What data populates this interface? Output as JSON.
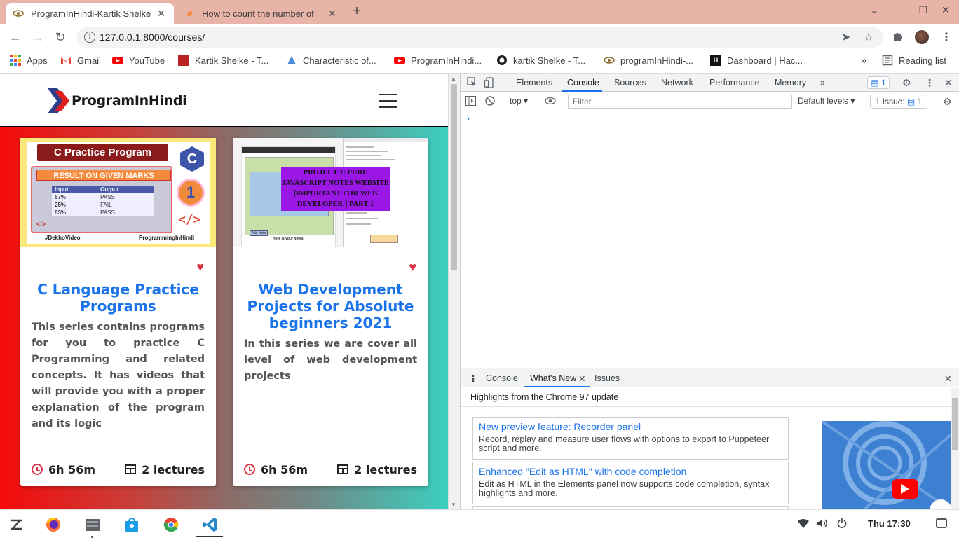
{
  "browser": {
    "tabs": [
      {
        "title": "ProgramInHindi-Kartik Shelke",
        "active": true
      },
      {
        "title": "How to count the number of",
        "active": false
      }
    ],
    "new_tab_label": "+",
    "url": "127.0.0.1:8000/courses/",
    "bookmarks": [
      {
        "label": "Apps",
        "icon": "apps-grid-icon"
      },
      {
        "label": "Gmail",
        "icon": "gmail-icon"
      },
      {
        "label": "YouTube",
        "icon": "youtube-icon"
      },
      {
        "label": "Kartik Shelke - T...",
        "icon": "bookmark-favicon"
      },
      {
        "label": "Characteristic of...",
        "icon": "bookmark-favicon"
      },
      {
        "label": "ProgramInHindi...",
        "icon": "youtube-icon"
      },
      {
        "label": "kartik Shelke - T...",
        "icon": "github-icon"
      },
      {
        "label": "programInHindi-...",
        "icon": "eye-favicon"
      },
      {
        "label": "Dashboard | Hac...",
        "icon": "hackerrank-icon"
      }
    ],
    "more_bookmarks": "»",
    "reading_list": "Reading list"
  },
  "site": {
    "logo_text": "ProgramInHindi",
    "cards": [
      {
        "title": "C Language Practice Programs",
        "description": "This series contains programs for you to practice C Programming and related concepts. It has videos that will provide you with a proper explanation of the program and its logic",
        "duration": "6h 56m",
        "lectures": "2 lectures",
        "thumb": {
          "header": "C Practice Program",
          "result": "RESULT ON GIVEN MARKS",
          "table_headers": [
            "Input",
            "Output"
          ],
          "table_rows": [
            [
              "67%",
              "PASS"
            ],
            [
              "25%",
              "FAIL"
            ],
            [
              "83%",
              "PASS"
            ]
          ],
          "c_letter": "C",
          "number": "1",
          "code_mark": "</>",
          "tag_left": "#DekhoVideo",
          "tag_right": "ProgrammingInHindi"
        }
      },
      {
        "title": "Web Development Projects for Absolute beginners 2021",
        "description": "In this series we are cover all level of web development projects",
        "duration": "6h 56m",
        "lectures": "2 lectures",
        "thumb": {
          "badge": "PROJECT 1: PURE JAVASCRIPT NOTES WEBSITE [IMPORTANT FOR WEB DEVELOPER ] PART 1",
          "notes_caption": "Here is your notes",
          "add_button": "Add Note"
        }
      }
    ]
  },
  "devtools": {
    "tabs": [
      "Elements",
      "Console",
      "Sources",
      "Network",
      "Performance",
      "Memory"
    ],
    "active_tab": "Console",
    "more": "»",
    "issue_count": "1",
    "context": "top",
    "filter_placeholder": "Filter",
    "levels": "Default levels",
    "issues_label": "1 Issue:",
    "issues_count": "1",
    "prompt": "›",
    "drawer": {
      "tabs": [
        "Console",
        "What's New",
        "Issues"
      ],
      "active_tab": "What's New",
      "highlights": "Highlights from the Chrome 97 update",
      "items": [
        {
          "title": "New preview feature: Recorder panel",
          "desc": "Record, replay and measure user flows with options to export to Puppeteer script and more."
        },
        {
          "title": "Enhanced \"Edit as HTML\" with code completion",
          "desc": "Edit as HTML in the Elements panel now supports code completion, syntax highlights and more."
        }
      ]
    }
  },
  "shelf": {
    "time": "Thu 17:30",
    "apps": [
      "launcher-icon",
      "firefox-icon",
      "files-icon",
      "store-icon",
      "chrome-icon",
      "vscode-icon"
    ]
  },
  "colors": {
    "tabstrip": "#e8b4a8",
    "card_title": "#1a73e8",
    "accent_red": "#dc3545",
    "devtools_blue": "#1a73e8"
  }
}
